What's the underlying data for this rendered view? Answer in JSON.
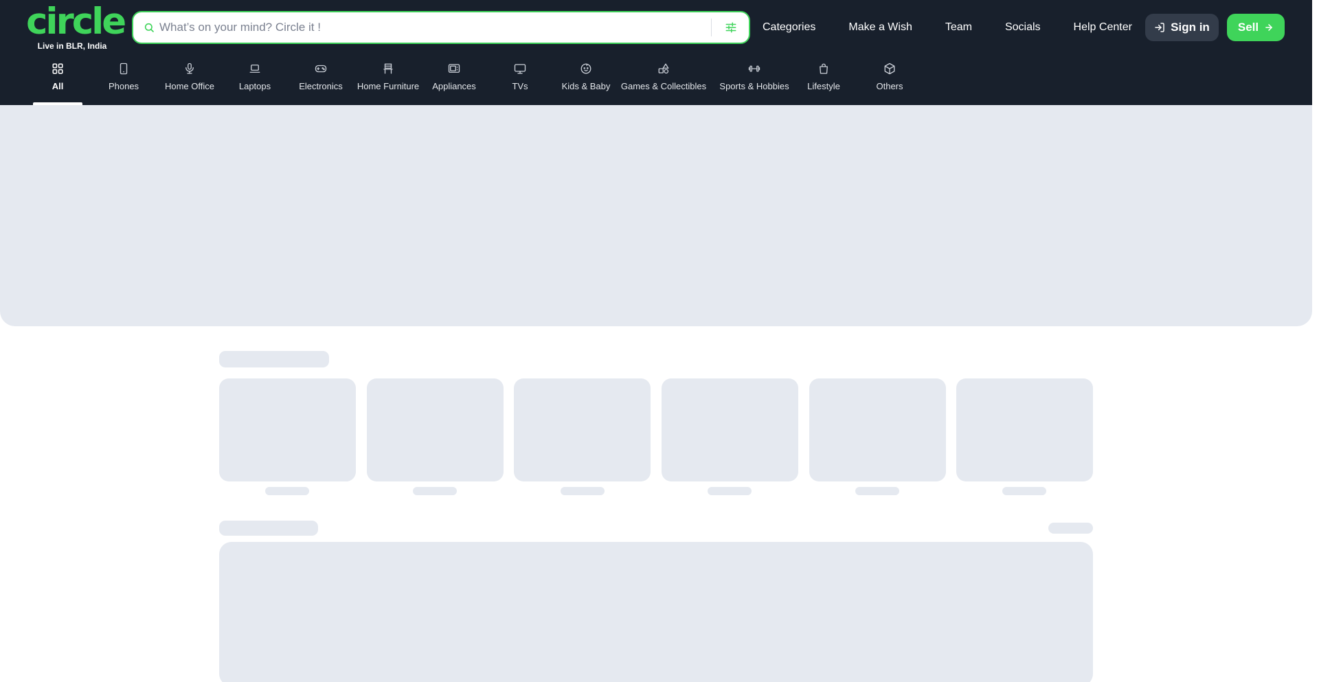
{
  "logo": {
    "word": "circle",
    "tagline": "Live in BLR, India"
  },
  "search": {
    "placeholder": "What’s on your mind? Circle it !"
  },
  "topnav": {
    "items": [
      {
        "label": "Categories"
      },
      {
        "label": "Make a Wish"
      },
      {
        "label": "Team"
      },
      {
        "label": "Socials"
      },
      {
        "label": "Help Center"
      }
    ]
  },
  "actions": {
    "signin_label": "Sign in",
    "sell_label": "Sell"
  },
  "categories": [
    {
      "label": "All",
      "icon": "grid-icon"
    },
    {
      "label": "Phones",
      "icon": "phone-icon"
    },
    {
      "label": "Home Office",
      "icon": "microphone-icon"
    },
    {
      "label": "Laptops",
      "icon": "laptop-icon"
    },
    {
      "label": "Electronics",
      "icon": "gamepad-icon"
    },
    {
      "label": "Home Furniture",
      "icon": "chair-icon"
    },
    {
      "label": "Appliances",
      "icon": "microwave-icon"
    },
    {
      "label": "TVs",
      "icon": "tv-icon"
    },
    {
      "label": "Kids & Baby",
      "icon": "baby-icon"
    },
    {
      "label": "Games & Collectibles",
      "icon": "shapes-icon"
    },
    {
      "label": "Sports & Hobbies",
      "icon": "dumbbell-icon"
    },
    {
      "label": "Lifestyle",
      "icon": "shopping-bag-icon"
    },
    {
      "label": "Others",
      "icon": "box-icon"
    }
  ],
  "active_category": "All",
  "colors": {
    "brand_green": "#3fd45a",
    "header_bg": "#18202c",
    "skeleton": "#e5e9f0",
    "signin_bg": "#333c4a"
  }
}
